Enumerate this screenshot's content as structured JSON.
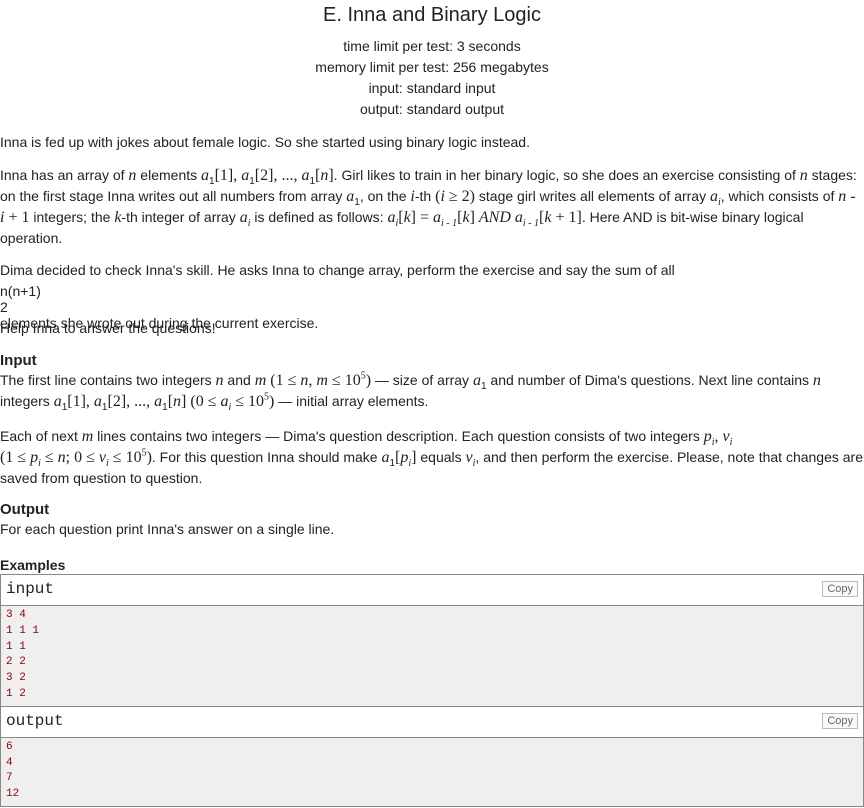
{
  "header": {
    "title": "E. Inna and Binary Logic",
    "limits": [
      "time limit per test: 3 seconds",
      "memory limit per test: 256 megabytes",
      "input: standard input",
      "output: standard output"
    ]
  },
  "legend": {
    "p1": "Inna is fed up with jokes about female logic. So she started using binary logic instead.",
    "p2a": "Inna has an array of ",
    "p2b": " elements ",
    "p2c": ". Girl likes to train in her binary logic, so she does an exercise consisting of ",
    "p2d": " stages: on the first stage Inna writes out all numbers from array ",
    "p2e": ", on the ",
    "p2f": "-th ",
    "p2g": " stage girl writes all elements of array ",
    "p2h": ", which consists of ",
    "p2i": " integers; the ",
    "p2j": "-th integer of array ",
    "p2k": " is defined as follows: ",
    "p2l": ". Here AND is bit-wise binary logical operation.",
    "p3a": "Dima decided to check Inna's skill. He asks Inna to change array, perform the exercise and say the sum of all ",
    "p3b": " elements she wrote out during the current exercise.",
    "p4": "Help Inna to answer the questions!"
  },
  "input_section": {
    "title": "Input",
    "p1a": "The first line contains two integers ",
    "p1b": " and ",
    "p1c": " — size of array ",
    "p1d": " and number of Dima's questions. Next line contains ",
    "p1e": " integers ",
    "p1f": " — initial array elements.",
    "p2a": "Each of next ",
    "p2b": " lines contains two integers — Dima's question description. Each question consists of two integers ",
    "p2c": ". For this question Inna should make ",
    "p2d": " equals ",
    "p2e": ", and then perform the exercise. Please, note that changes are saved from question to question."
  },
  "output_section": {
    "title": "Output",
    "text": "For each question print Inna's answer on a single line."
  },
  "examples": {
    "title": "Examples",
    "input_label": "input",
    "output_label": "output",
    "copy_label": "Copy",
    "input_lines": [
      "3 4",
      "1 1 1",
      "1 1",
      "2 2",
      "3 2",
      "1 2"
    ],
    "output_lines": [
      "6",
      "4",
      "7",
      "12"
    ]
  }
}
